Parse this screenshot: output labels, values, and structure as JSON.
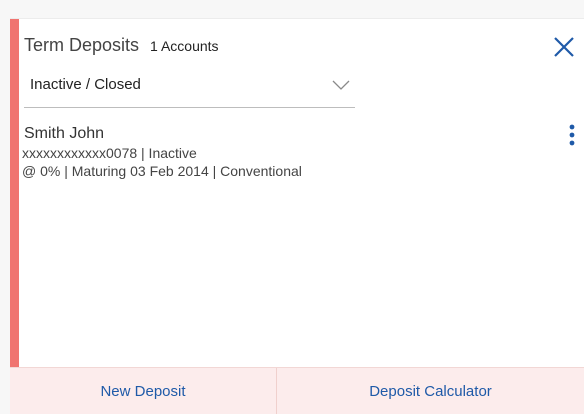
{
  "colors": {
    "accent_bar": "#f07470",
    "primary": "#1f5aa8",
    "footer_bg": "#fcecec"
  },
  "header": {
    "title": "Term Deposits",
    "count": "1 Accounts",
    "close_icon": "close-icon"
  },
  "filter": {
    "selected": "Inactive / Closed",
    "icon": "chevron-down-icon"
  },
  "accounts": [
    {
      "name": "Smith John",
      "line1": "xxxxxxxxxxxx0078 | Inactive",
      "line2": "@ 0% | Maturing 03 Feb 2014 | Conventional",
      "menu_icon": "more-vertical-icon"
    }
  ],
  "footer": {
    "new_deposit": "New Deposit",
    "deposit_calculator": "Deposit Calculator"
  }
}
